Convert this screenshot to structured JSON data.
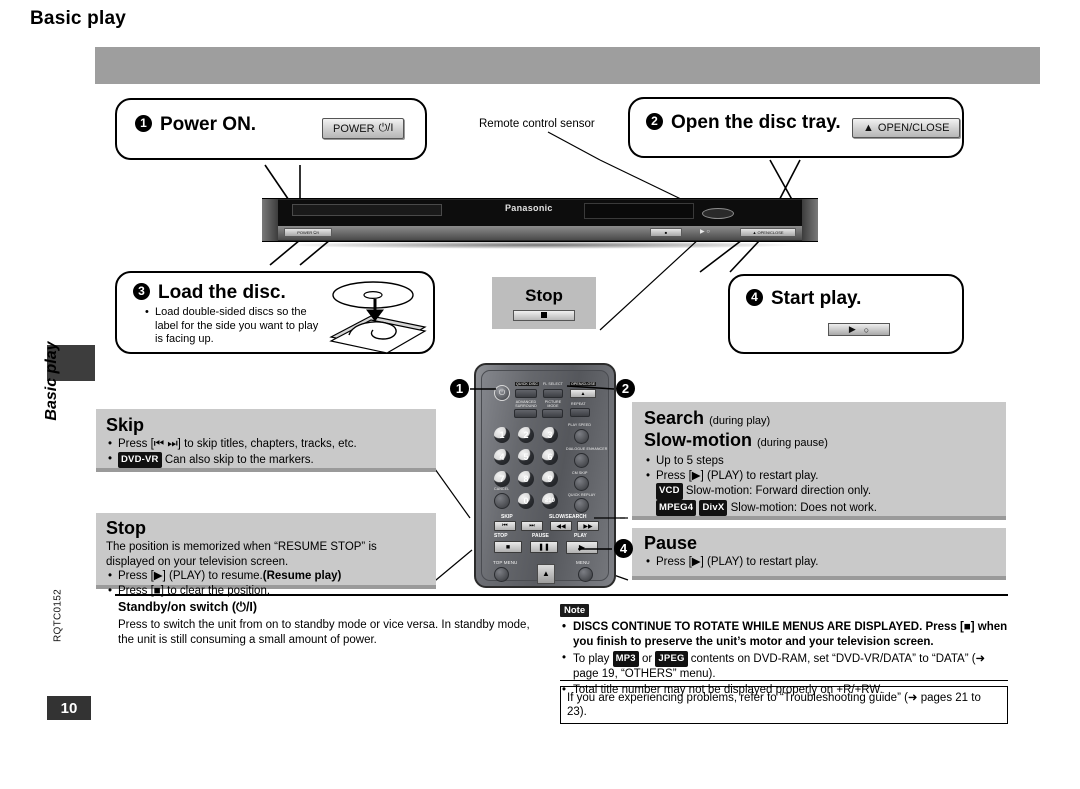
{
  "sidebar": {
    "vertical_title": "Basic play",
    "doc_code": "RQTC0152",
    "page_number": "10"
  },
  "header": {
    "title": "Basic play"
  },
  "steps": [
    {
      "num": "1",
      "title": "Power ON.",
      "key_label": "POWER",
      "key_symbol": "⏻/I"
    },
    {
      "num": "2",
      "title": "Open the disc tray.",
      "key_label": "OPEN/CLOSE",
      "key_symbol": "▲"
    },
    {
      "num": "3",
      "title": "Load the disc.",
      "bullet": "Load double-sided discs so the label for the side you want to play is facing up."
    },
    {
      "num": "4",
      "title": "Start play.",
      "key_symbol": "▶"
    }
  ],
  "device": {
    "brand": "Panasonic",
    "sensor_label": "Remote control sensor",
    "power_key": "POWER ⏻/I",
    "open_close_key": "▲ OPEN/CLOSE"
  },
  "stop_preview": {
    "label": "Stop"
  },
  "remote": {
    "markers": [
      "1",
      "2",
      "4"
    ],
    "top_labels": [
      "QUICK DISC",
      "FL SELECT",
      "OPEN/CLOSE"
    ],
    "func_labels": [
      "ADVANCED SURROUND",
      "PICTURE MODE",
      "REPEAT"
    ],
    "side_labels": [
      "PLAY SPEED",
      "DIALOGUE ENHANCER",
      "CM SKIP",
      "QUICK REPLAY"
    ],
    "cancel_label": "CANCEL",
    "numbers": [
      "1",
      "2",
      "3",
      "4",
      "5",
      "6",
      "7",
      "8",
      "9",
      "0",
      "≥10"
    ],
    "group_skip": "SKIP",
    "group_slowsearch": "SLOW/SEARCH",
    "transport": [
      "STOP",
      "PAUSE",
      "PLAY"
    ],
    "bottom_labels": [
      "TOP MENU",
      "MENU"
    ]
  },
  "panels": {
    "skip": {
      "title": "Skip",
      "items": [
        {
          "text": "Press [⏮ ⏭] to skip titles, chapters, tracks, etc."
        },
        {
          "tag": "DVD-VR",
          "text": "Can also skip to the markers."
        }
      ]
    },
    "stop": {
      "title": "Stop",
      "body": "The position is memorized when “RESUME STOP” is displayed on your television screen.",
      "items": [
        {
          "text": "Press [▶] (PLAY) to resume.",
          "bold_suffix": "(Resume play)"
        },
        {
          "text": "Press [■] to clear the position."
        }
      ]
    },
    "search": {
      "title": "Search",
      "title_note": "(during play)",
      "title2": "Slow-motion",
      "title2_note": "(during pause)",
      "items": [
        {
          "text": "Up to 5 steps"
        },
        {
          "text": "Press [▶] (PLAY) to restart play."
        },
        {
          "tag": "VCD",
          "text": "Slow-motion: Forward direction only.",
          "noBullet": true
        },
        {
          "tag": "MPEG4",
          "tag2": "DivX",
          "text": "Slow-motion: Does not work.",
          "noBullet": true
        }
      ]
    },
    "pause": {
      "title": "Pause",
      "items": [
        {
          "text": "Press [▶] (PLAY) to restart play."
        }
      ]
    }
  },
  "bottom_left": {
    "heading": "Standby/on switch (⏻/I)",
    "body": "Press to switch the unit from on to standby mode or vice versa. In standby mode, the unit is still consuming a small amount of power."
  },
  "bottom_right": {
    "note_badge": "Note",
    "items": [
      {
        "bold": true,
        "text": "DISCS CONTINUE TO ROTATE WHILE MENUS ARE DISPLAYED. Press [■] when you finish to preserve the unit’s motor and your television screen."
      },
      {
        "bold": false,
        "prefix": "To play",
        "tag": "MP3",
        "mid": "or",
        "tag2": "JPEG",
        "text": "contents on DVD-RAM, set “DVD-VR/DATA” to “DATA” (➜ page 19, “OTHERS” menu)."
      },
      {
        "bold": false,
        "text": "Total title number may not be displayed properly on +R/+RW."
      }
    ],
    "troubleshooting": "If you are experiencing problems, refer to “Troubleshooting guide” (➜ pages 21 to 23)."
  },
  "colors": {
    "header_bar": "#9e9e9e",
    "panel_bg": "#c9c9c9",
    "panel_shadow": "#9a9a9a",
    "page_badge": "#333333"
  }
}
